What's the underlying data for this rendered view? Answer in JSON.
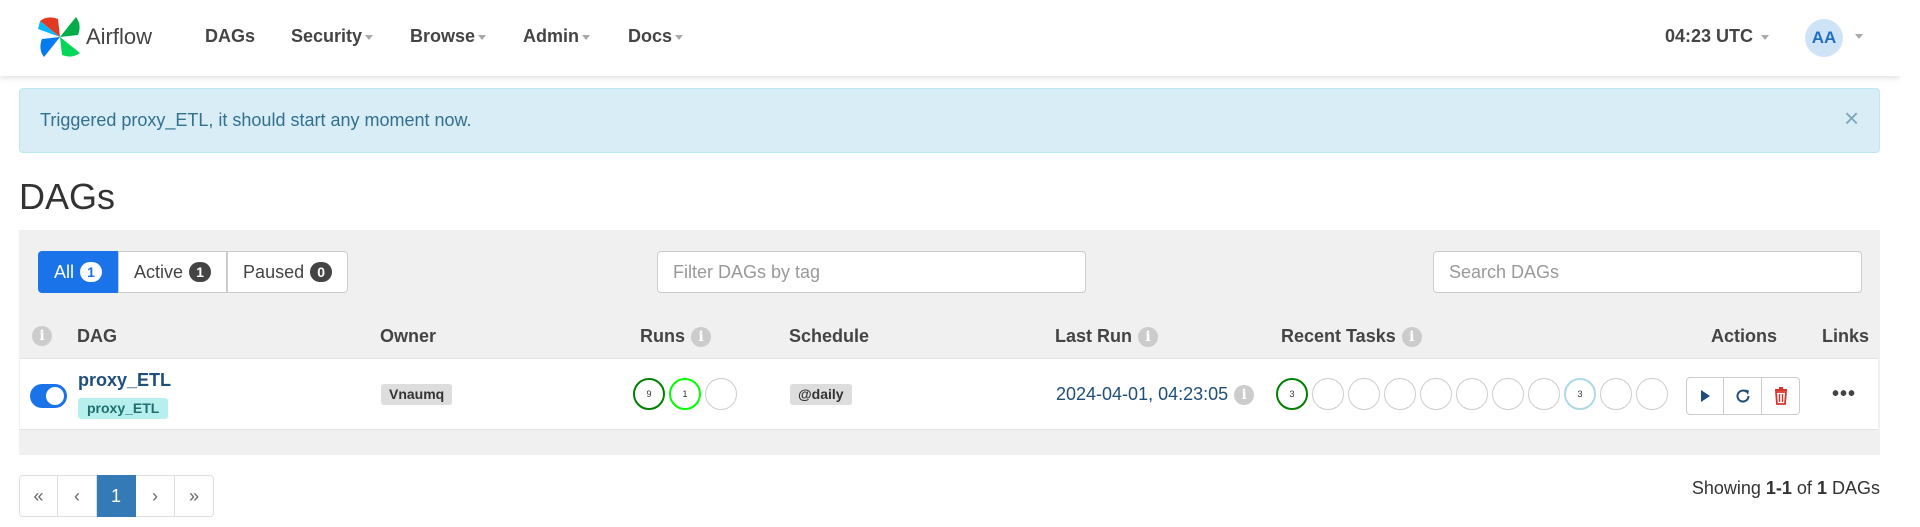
{
  "brand": {
    "name": "Airflow"
  },
  "nav": {
    "items": [
      {
        "label": "DAGs",
        "dropdown": false
      },
      {
        "label": "Security",
        "dropdown": true
      },
      {
        "label": "Browse",
        "dropdown": true
      },
      {
        "label": "Admin",
        "dropdown": true
      },
      {
        "label": "Docs",
        "dropdown": true
      }
    ],
    "clock": "04:23 UTC",
    "user_initials": "AA"
  },
  "alert": {
    "message": "Triggered proxy_ETL, it should start any moment now.",
    "close": "×"
  },
  "page": {
    "title": "DAGs"
  },
  "filters": {
    "all_label": "All",
    "all_count": "1",
    "active_label": "Active",
    "active_count": "1",
    "paused_label": "Paused",
    "paused_count": "0",
    "tag_placeholder": "Filter DAGs by tag",
    "search_placeholder": "Search DAGs"
  },
  "table": {
    "headers": {
      "dag": "DAG",
      "owner": "Owner",
      "runs": "Runs",
      "schedule": "Schedule",
      "last_run": "Last Run",
      "recent_tasks": "Recent Tasks",
      "actions": "Actions",
      "links": "Links"
    },
    "info_glyph": "i",
    "rows": [
      {
        "dag_id": "proxy_ETL",
        "tag": "proxy_ETL",
        "owner": "Vnaumq",
        "runs": [
          {
            "count": "9",
            "color": "#008000"
          },
          {
            "count": "1",
            "color": "#00ff00"
          },
          {
            "count": "",
            "color": "#cccccc"
          }
        ],
        "schedule": "@daily",
        "last_run": "2024-04-01, 04:23:05",
        "recent_tasks": [
          {
            "count": "3",
            "color": "#008000"
          },
          {
            "count": "",
            "color": "#cccccc"
          },
          {
            "count": "",
            "color": "#cccccc"
          },
          {
            "count": "",
            "color": "#cccccc"
          },
          {
            "count": "",
            "color": "#cccccc"
          },
          {
            "count": "",
            "color": "#cccccc"
          },
          {
            "count": "",
            "color": "#cccccc"
          },
          {
            "count": "",
            "color": "#cccccc"
          },
          {
            "count": "3",
            "color": "#add8e6"
          },
          {
            "count": "",
            "color": "#cccccc"
          },
          {
            "count": "",
            "color": "#cccccc"
          }
        ],
        "links_glyph": "•••"
      }
    ]
  },
  "pagination": {
    "first": "«",
    "prev": "‹",
    "current": "1",
    "next": "›",
    "last": "»"
  },
  "summary": {
    "prefix": "Showing",
    "range": "1-1",
    "of": "of",
    "total": "1",
    "suffix": "DAGs"
  },
  "colors": {
    "primary": "#1a73e8",
    "alert_bg": "#d9edf7",
    "delete": "#d9342b"
  }
}
